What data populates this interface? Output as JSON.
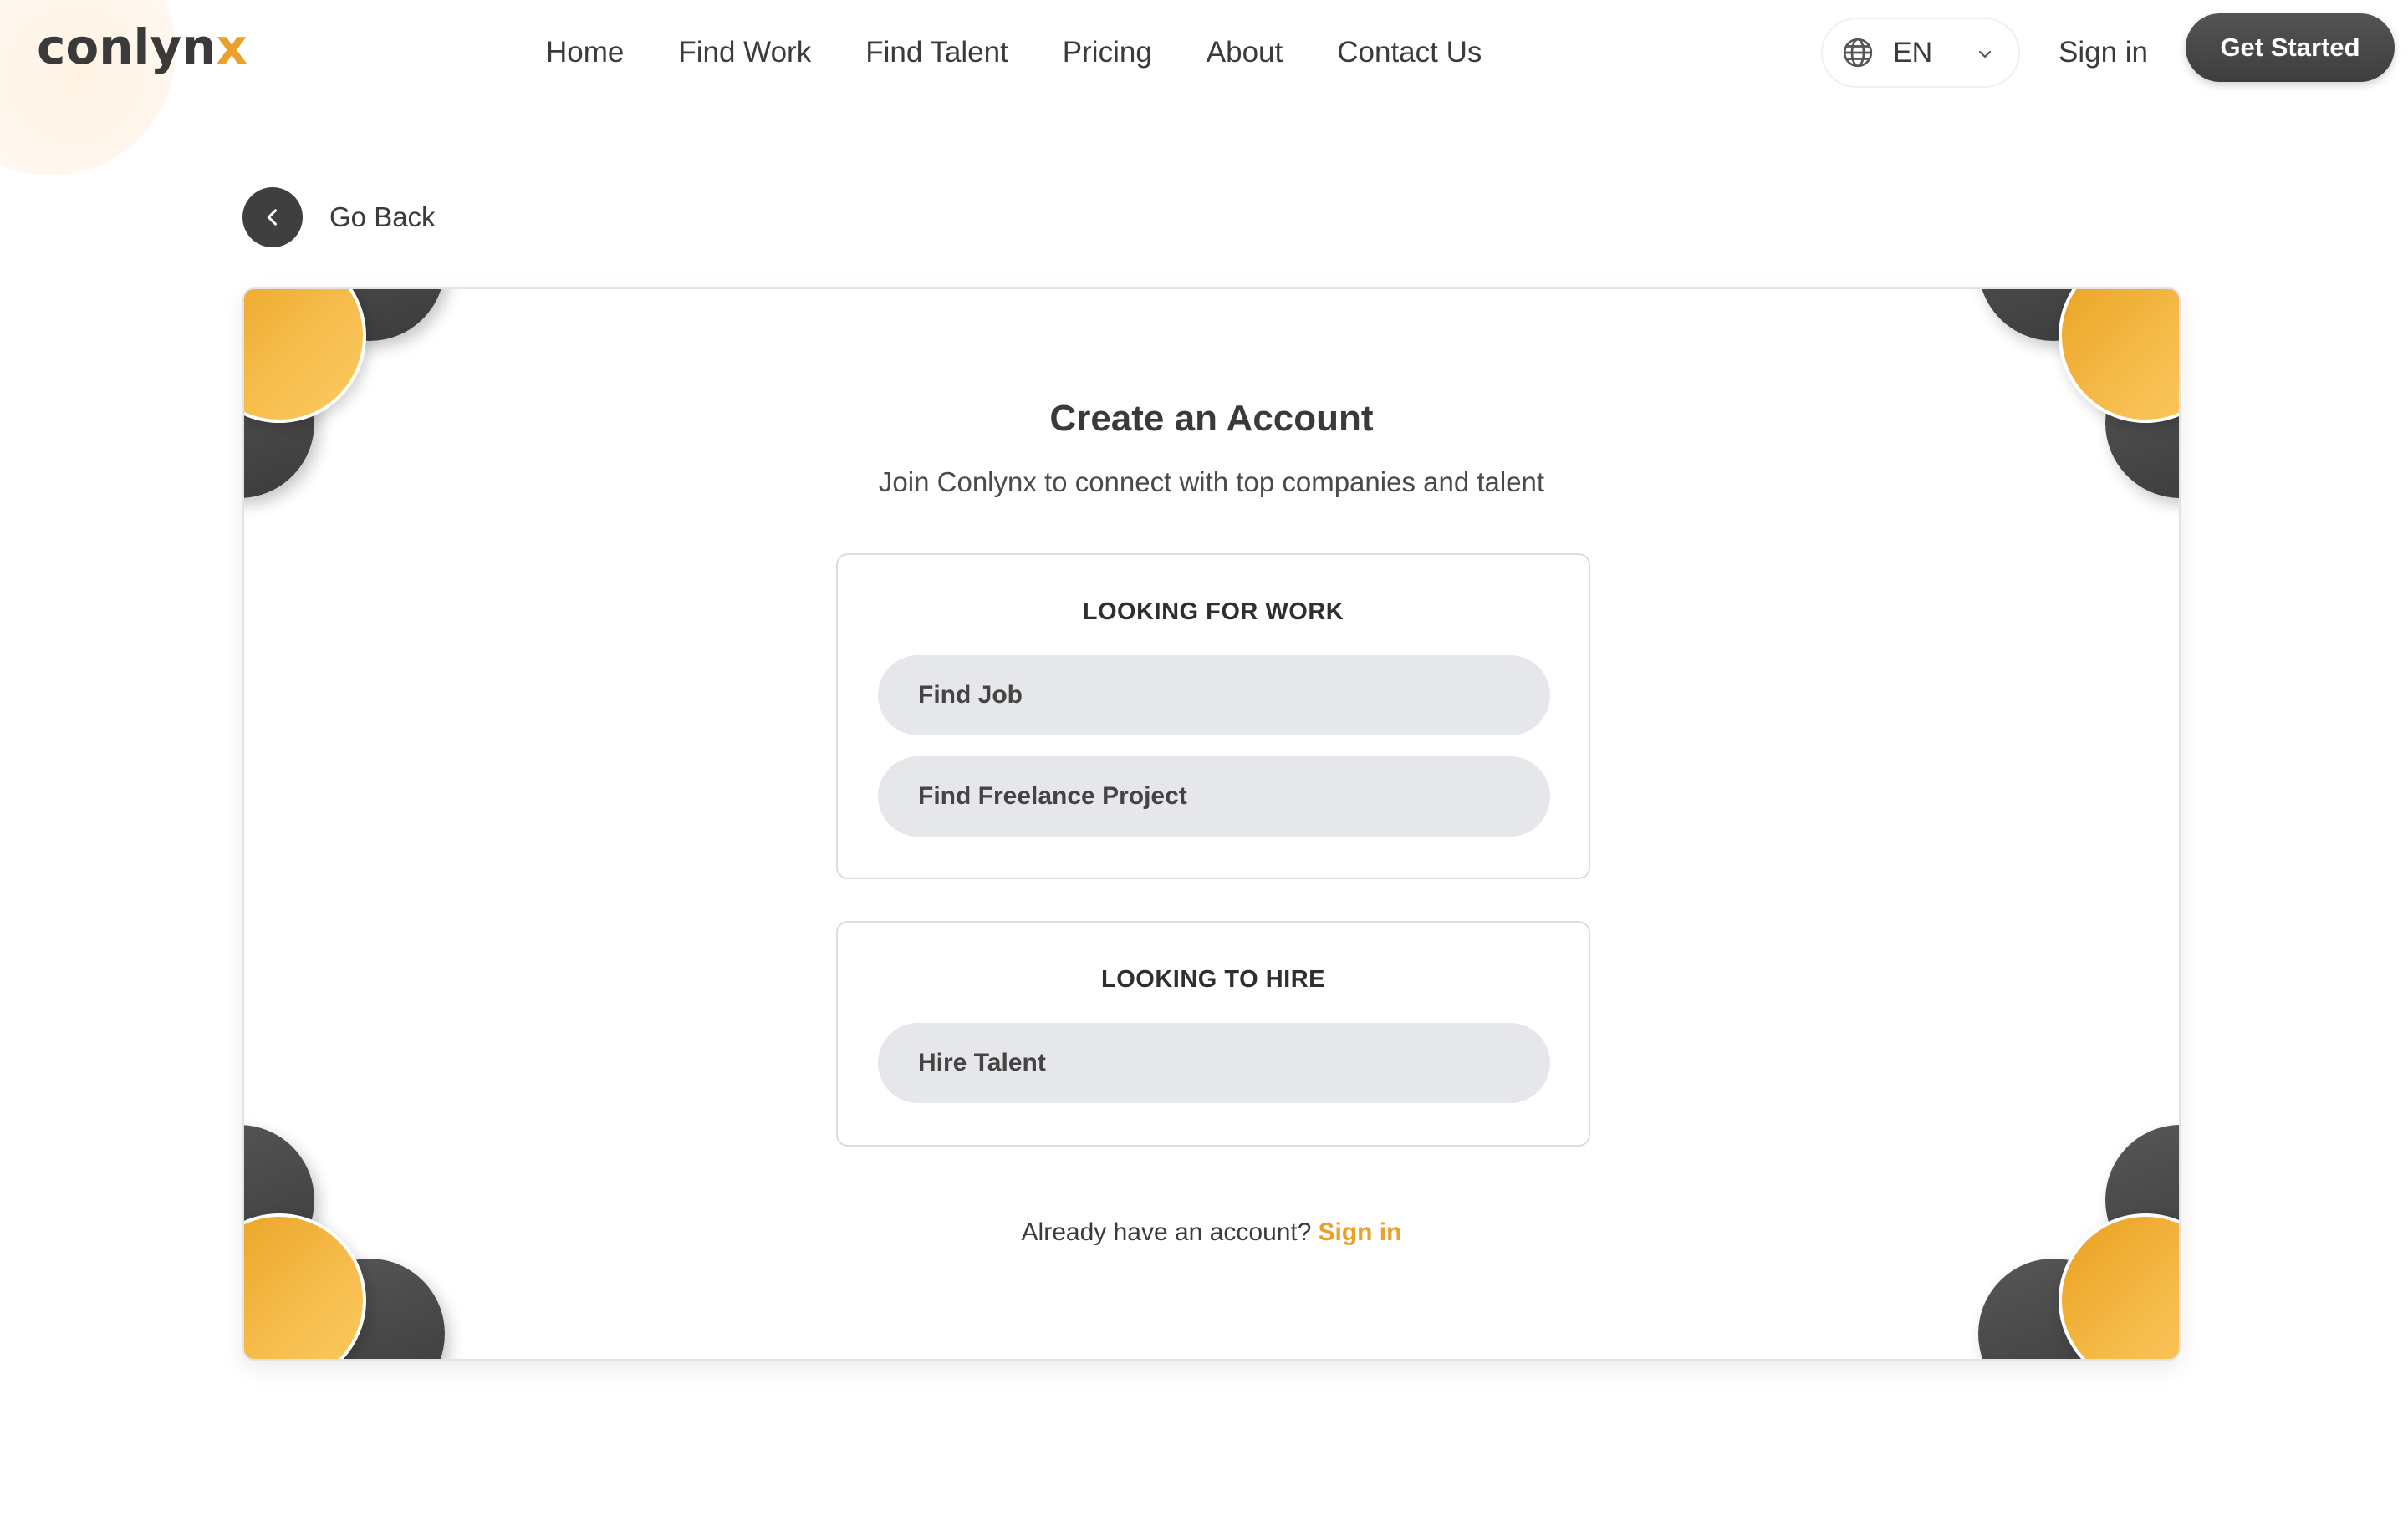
{
  "header": {
    "logo": {
      "main": "conlyn",
      "accent": "x"
    },
    "nav": [
      "Home",
      "Find Work",
      "Find Talent",
      "Pricing",
      "About",
      "Contact Us"
    ],
    "language": "EN",
    "sign_in": "Sign in",
    "get_started": "Get Started"
  },
  "go_back": "Go Back",
  "card": {
    "title": "Create an Account",
    "subtitle": "Join Conlynx to connect with top companies and talent",
    "work_section": {
      "title": "LOOKING FOR WORK",
      "options": [
        "Find Job",
        "Find Freelance Project"
      ]
    },
    "hire_section": {
      "title": "LOOKING TO HIRE",
      "options": [
        "Hire Talent"
      ]
    },
    "footer": {
      "prompt": "Already have an account?",
      "link": "Sign in"
    }
  },
  "colors": {
    "accent": "#eba02b",
    "dark": "#3f3f3f",
    "option_bg": "#e6e7ea"
  },
  "icons": {
    "language": "globe-icon",
    "language_dropdown": "chevron-down-icon",
    "back": "chevron-left-icon"
  }
}
